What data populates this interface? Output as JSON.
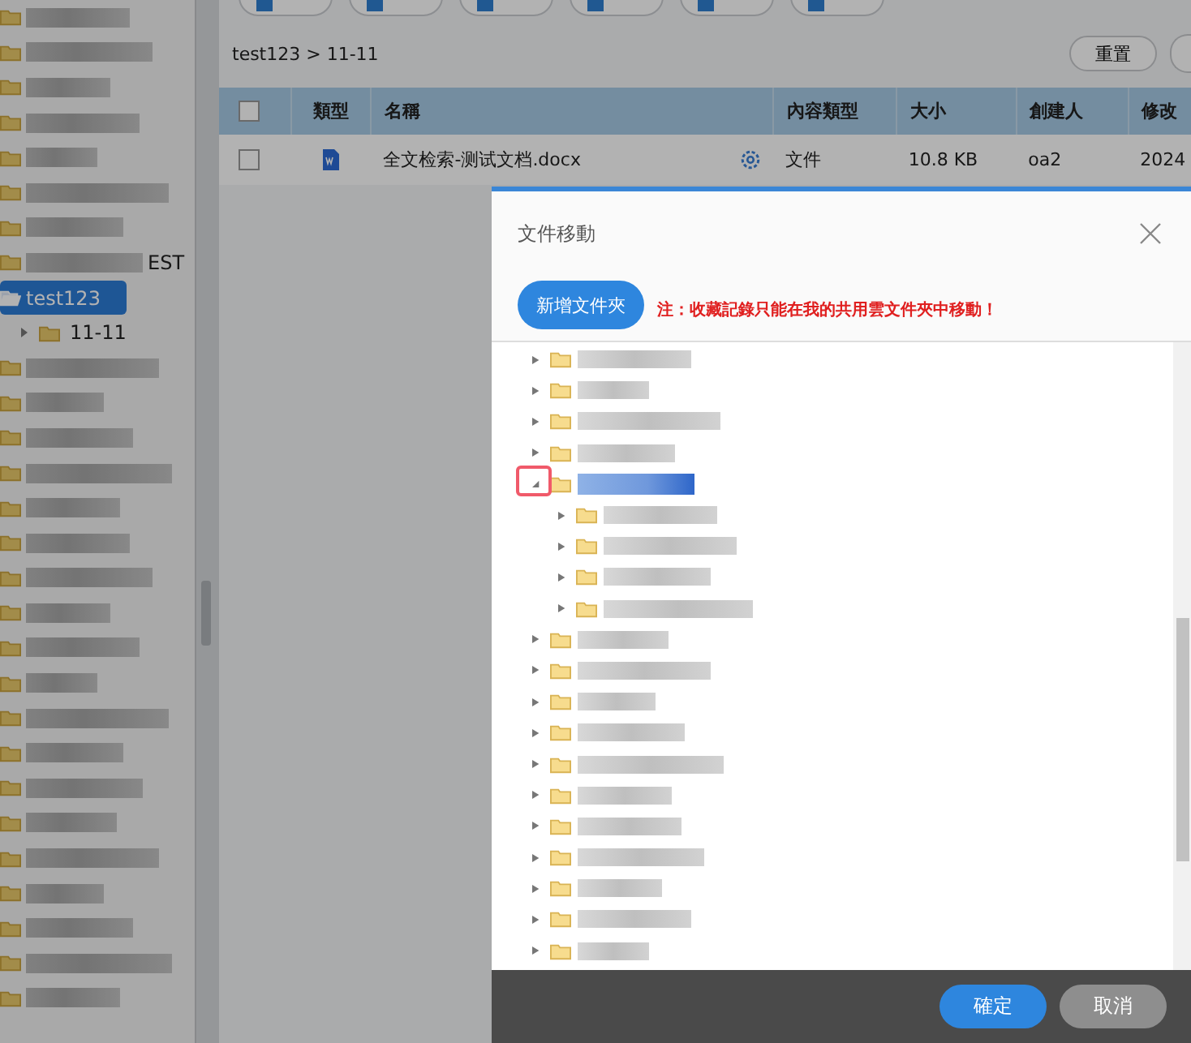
{
  "sidebar": {
    "items": [
      {
        "selected": false
      },
      {
        "selected": false
      },
      {
        "selected": false
      },
      {
        "selected": false
      },
      {
        "selected": false
      },
      {
        "selected": false
      },
      {
        "selected": false
      },
      {
        "text": "EST",
        "selected": false
      },
      {
        "text": "test123",
        "selected": true,
        "expanded": true,
        "children": [
          {
            "text": "11-11",
            "selected": false,
            "expanded": false
          }
        ]
      },
      {
        "selected": false
      },
      {
        "selected": false
      },
      {
        "selected": false
      },
      {
        "selected": false
      },
      {
        "selected": false
      },
      {
        "selected": false
      },
      {
        "selected": false
      },
      {
        "selected": false
      },
      {
        "selected": false
      },
      {
        "selected": false
      },
      {
        "selected": false
      },
      {
        "selected": false
      },
      {
        "selected": false
      },
      {
        "selected": false
      },
      {
        "selected": false
      },
      {
        "selected": false
      },
      {
        "selected": false
      },
      {
        "selected": false
      },
      {
        "selected": false
      }
    ]
  },
  "breadcrumb": "test123 > 11-11",
  "reset_button": "重置",
  "table": {
    "select_all_checked": false,
    "columns": [
      "類型",
      "名稱",
      "內容類型",
      "大小",
      "創建人",
      "修改"
    ],
    "rows": [
      {
        "checked": false,
        "name": "全文检索-测试文档.docx",
        "content_type": "文件",
        "size": "10.8 KB",
        "creator": "oa2",
        "modified": "2024"
      }
    ]
  },
  "dialog": {
    "title": "文件移動",
    "new_folder_button": "新增文件夾",
    "note": "注：收藏記錄只能在我的共用雲文件夾中移動！",
    "tree": [
      {
        "selected": false,
        "expanded": false
      },
      {
        "selected": false,
        "expanded": false
      },
      {
        "selected": false,
        "expanded": false
      },
      {
        "selected": false,
        "expanded": false
      },
      {
        "selected": true,
        "expanded": true,
        "children": [
          {
            "selected": false,
            "expanded": false
          },
          {
            "selected": false,
            "expanded": false
          },
          {
            "selected": false,
            "expanded": false
          },
          {
            "selected": false,
            "expanded": false
          }
        ]
      },
      {
        "selected": false,
        "expanded": false
      },
      {
        "selected": false,
        "expanded": false
      },
      {
        "selected": false,
        "expanded": false
      },
      {
        "selected": false,
        "expanded": false
      },
      {
        "selected": false,
        "expanded": false
      },
      {
        "selected": false,
        "expanded": false
      },
      {
        "selected": false,
        "expanded": false
      },
      {
        "selected": false,
        "expanded": false
      },
      {
        "selected": false,
        "expanded": false
      },
      {
        "selected": false,
        "expanded": false
      },
      {
        "selected": false,
        "expanded": false
      }
    ],
    "buttons": [
      "確定",
      "取消"
    ]
  }
}
